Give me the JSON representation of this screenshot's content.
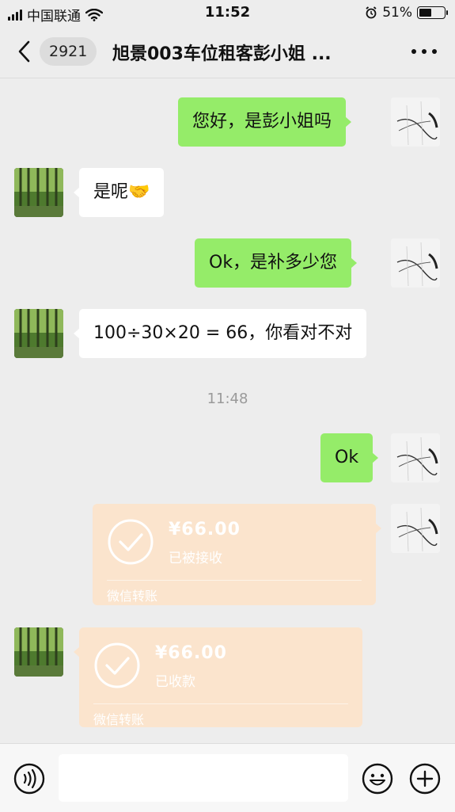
{
  "status_bar": {
    "carrier": "中国联通",
    "time": "11:52",
    "battery_percent_text": "51%",
    "battery_level": 0.51
  },
  "nav": {
    "unread_count": "2921",
    "title": "旭景003车位租客彭小姐 ..."
  },
  "messages": [
    {
      "sender": "self",
      "text": "您好，是彭小姐吗"
    },
    {
      "sender": "peer",
      "text": "是呢🤝"
    },
    {
      "sender": "self",
      "text": "Ok，是补多少您"
    },
    {
      "sender": "peer",
      "text": "100÷30×20 = 66，你看对不对"
    },
    {
      "sender": "self",
      "text": "Ok"
    }
  ],
  "timestamp": "11:48",
  "transfers": [
    {
      "sender": "self",
      "amount": "¥66.00",
      "status": "已被接收",
      "footer": "微信转账"
    },
    {
      "sender": "peer",
      "amount": "¥66.00",
      "status": "已收款",
      "footer": "微信转账"
    }
  ],
  "icons": {
    "back": "chevron-left-icon",
    "more": "more-icon",
    "voice": "voice-icon",
    "emoji": "emoji-icon",
    "plus": "plus-icon",
    "check": "check-circle-icon"
  },
  "colors": {
    "background": "#ededed",
    "self_bubble": "#95ec69",
    "peer_bubble": "#ffffff",
    "transfer_card": "#fbe4cd",
    "timestamp": "#9a9a9a"
  }
}
